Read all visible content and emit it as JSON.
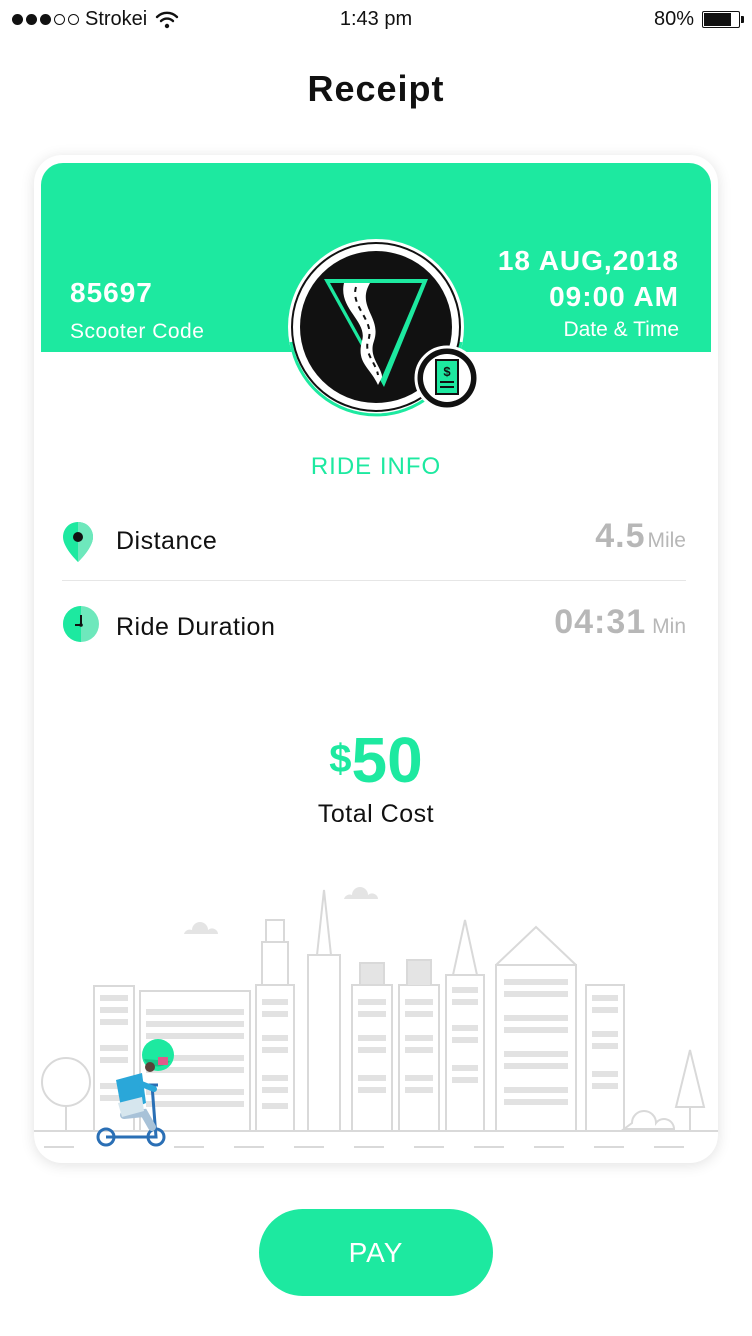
{
  "status_bar": {
    "carrier": "Strokei",
    "time": "1:43 pm",
    "battery": "80%"
  },
  "page": {
    "title": "Receipt"
  },
  "receipt": {
    "scooter_code": "85697",
    "scooter_code_label": "Scooter Code",
    "date": "18 AUG,2018",
    "time": "09:00 AM",
    "date_time_label": "Date & Time",
    "section_title": "RIDE INFO",
    "distance": {
      "label": "Distance",
      "value": "4.5",
      "unit": "Mile"
    },
    "duration": {
      "label": "Ride Duration",
      "value": "04:31",
      "unit": "Min"
    },
    "total": {
      "currency": "$",
      "amount": "50",
      "label": "Total Cost"
    }
  },
  "actions": {
    "pay_label": "PAY"
  },
  "colors": {
    "accent": "#1de9a0",
    "muted": "#b7b7b7",
    "dark": "#111111"
  }
}
